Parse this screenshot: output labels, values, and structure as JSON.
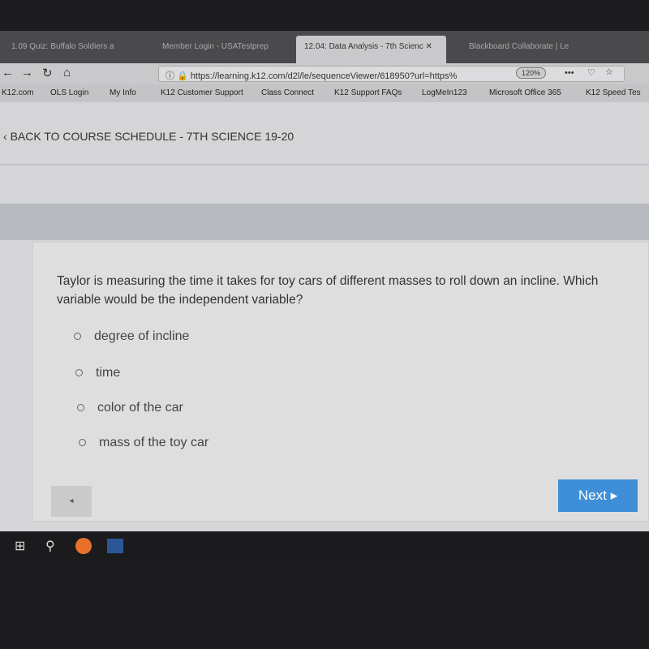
{
  "browser": {
    "tabs": [
      {
        "label": "1.09 Quiz: Buffalo Soldiers a",
        "active": false
      },
      {
        "label": "Member Login - USATestprep",
        "active": false
      },
      {
        "label": "12.04: Data Analysis - 7th Scienc",
        "active": true
      },
      {
        "label": "Blackboard Collaborate | Le",
        "active": false
      }
    ],
    "tab_close": "✕",
    "url": "https://learning.k12.com/d2l/le/sequenceViewer/618950?url=https%",
    "zoom": "120%",
    "bookmarks": [
      "K12.com",
      "OLS Login",
      "My Info",
      "K12 Customer Support",
      "Class Connect",
      "K12 Support FAQs",
      "LogMeIn123",
      "Microsoft Office 365",
      "K12 Speed Tes"
    ]
  },
  "page": {
    "back_link": "BACK TO COURSE SCHEDULE - 7TH SCIENCE 19-20",
    "question": "Taylor is measuring the time it takes for toy cars of different masses to roll down an incline. Which variable would be the independent variable?",
    "options": [
      "degree of incline",
      "time",
      "color of the car",
      "mass of the toy car"
    ],
    "prev_label": "◂",
    "next_label": "Next ▸"
  },
  "colors": {
    "accent": "#3e8fd8"
  }
}
